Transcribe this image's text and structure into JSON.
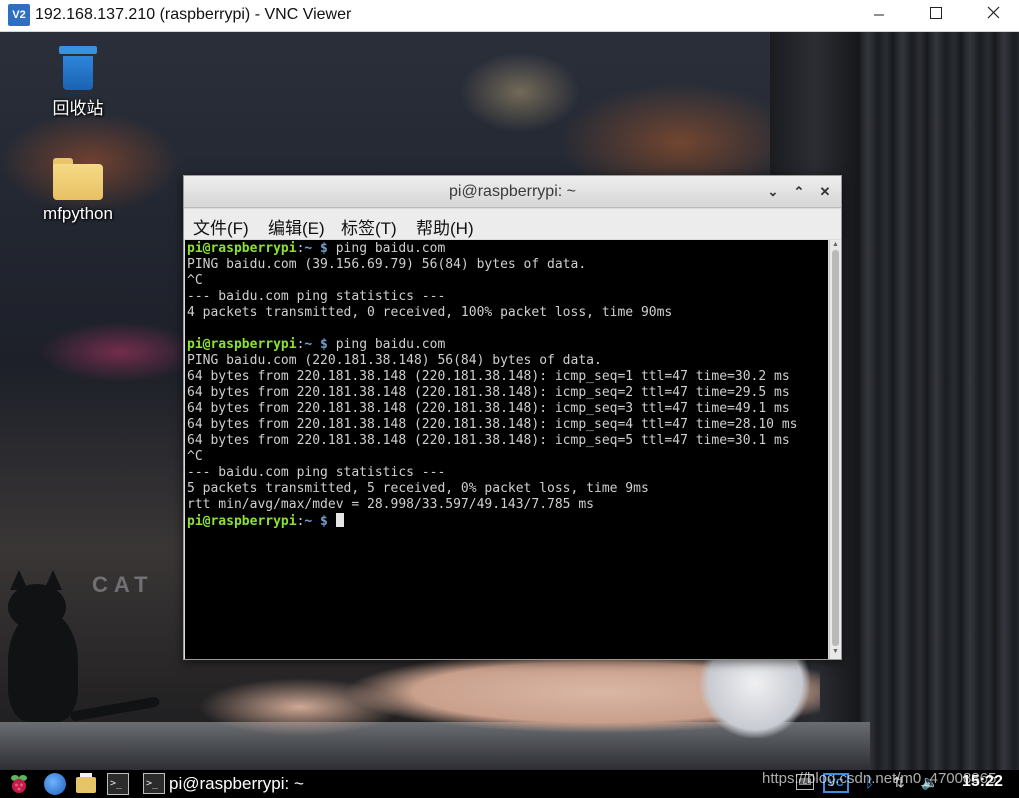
{
  "vnc_window": {
    "app_icon_text": "V2",
    "title": "192.168.137.210 (raspberrypi) - VNC Viewer",
    "minimize_glyph": "–",
    "maximize_glyph": "☐",
    "close_glyph": "✕"
  },
  "desktop": {
    "icons": [
      {
        "label": "回收站",
        "icon": "trash-icon"
      },
      {
        "label": "mfpython",
        "icon": "folder-icon"
      }
    ],
    "wallpaper_text": "CAT"
  },
  "terminal": {
    "title": "pi@raspberrypi: ~",
    "controls": {
      "minimize": "⌄",
      "maximize": "⌃",
      "close": "✕"
    },
    "menu": [
      "文件(F)",
      "编辑(E)",
      "标签(T)",
      "帮助(H)"
    ],
    "prompt": {
      "user": "pi@raspberrypi",
      "sep": ":",
      "path": "~",
      "symbol": " $ "
    },
    "lines": [
      {
        "type": "prompt",
        "command": "ping baidu.com"
      },
      {
        "type": "output",
        "text": "PING baidu.com (39.156.69.79) 56(84) bytes of data."
      },
      {
        "type": "output",
        "text": "^C"
      },
      {
        "type": "output",
        "text": "--- baidu.com ping statistics ---"
      },
      {
        "type": "output",
        "text": "4 packets transmitted, 0 received, 100% packet loss, time 90ms"
      },
      {
        "type": "output",
        "text": ""
      },
      {
        "type": "prompt",
        "command": "ping baidu.com"
      },
      {
        "type": "output",
        "text": "PING baidu.com (220.181.38.148) 56(84) bytes of data."
      },
      {
        "type": "output",
        "text": "64 bytes from 220.181.38.148 (220.181.38.148): icmp_seq=1 ttl=47 time=30.2 ms"
      },
      {
        "type": "output",
        "text": "64 bytes from 220.181.38.148 (220.181.38.148): icmp_seq=2 ttl=47 time=29.5 ms"
      },
      {
        "type": "output",
        "text": "64 bytes from 220.181.38.148 (220.181.38.148): icmp_seq=3 ttl=47 time=49.1 ms"
      },
      {
        "type": "output",
        "text": "64 bytes from 220.181.38.148 (220.181.38.148): icmp_seq=4 ttl=47 time=28.10 ms"
      },
      {
        "type": "output",
        "text": "64 bytes from 220.181.38.148 (220.181.38.148): icmp_seq=5 ttl=47 time=30.1 ms"
      },
      {
        "type": "output",
        "text": "^C"
      },
      {
        "type": "output",
        "text": "--- baidu.com ping statistics ---"
      },
      {
        "type": "output",
        "text": "5 packets transmitted, 5 received, 0% packet loss, time 9ms"
      },
      {
        "type": "output",
        "text": "rtt min/avg/max/mdev = 28.998/33.597/49.143/7.785 ms"
      },
      {
        "type": "prompt",
        "command": "",
        "cursor": true
      }
    ]
  },
  "taskbar": {
    "launchers": [
      "raspberry-menu-icon",
      "web-browser-icon",
      "file-manager-icon",
      "terminal-icon"
    ],
    "task_label": "pi@raspberrypi: ~",
    "terminal_icon_glyph": ">_",
    "tray": {
      "keyboard_glyph": "⌨",
      "vnc_label": "VC",
      "bluetooth_glyph": "ᛒ",
      "network_glyph": "⇅",
      "volume_glyph": "🔈"
    },
    "clock": "15:22",
    "watermark": "https://blog.csdn.net/m0_47008865"
  }
}
